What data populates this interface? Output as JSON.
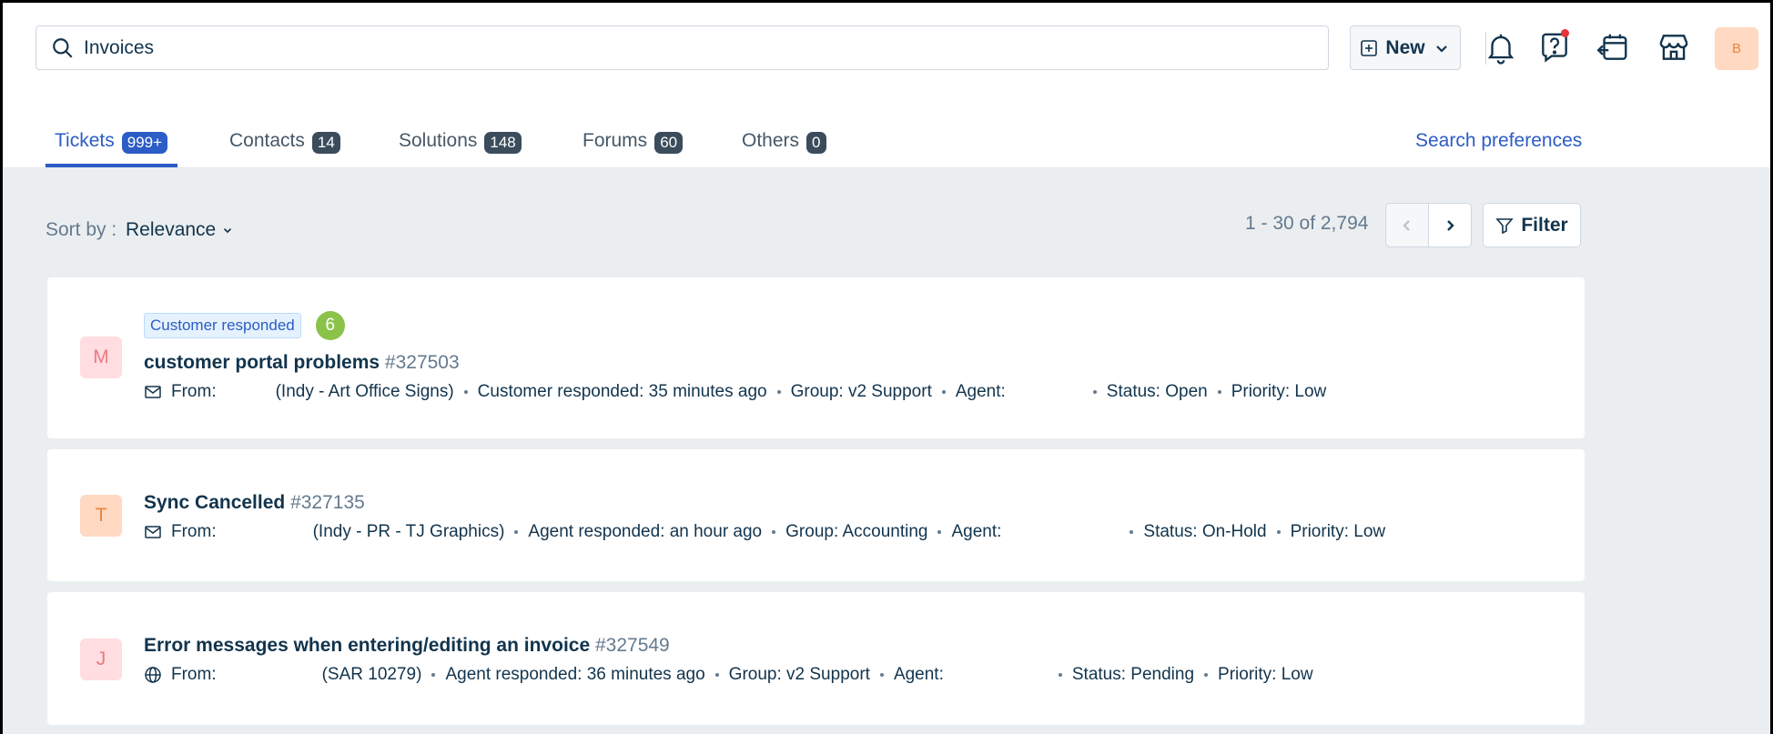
{
  "search": {
    "value": "Invoices"
  },
  "header": {
    "new_label": "New",
    "avatar_initial": "B"
  },
  "tabs": [
    {
      "label": "Tickets",
      "count": "999+"
    },
    {
      "label": "Contacts",
      "count": "14"
    },
    {
      "label": "Solutions",
      "count": "148"
    },
    {
      "label": "Forums",
      "count": "60"
    },
    {
      "label": "Others",
      "count": "0"
    }
  ],
  "search_preferences": "Search preferences",
  "sort": {
    "label": "Sort by :",
    "value": "Relevance"
  },
  "pagination": {
    "text": "1 - 30 of 2,794"
  },
  "filter_label": "Filter",
  "tickets": [
    {
      "initial": "M",
      "badge": "Customer responded",
      "count": "6",
      "title": "customer portal problems",
      "id": "#327503",
      "from_label": "From:",
      "company": "(Indy - Art Office Signs)",
      "activity": "Customer responded: 35 minutes ago",
      "group": "Group: v2 Support",
      "agent": "Agent:",
      "status": "Status: Open",
      "priority": "Priority: Low"
    },
    {
      "initial": "T",
      "title": "Sync Cancelled",
      "id": "#327135",
      "from_label": "From:",
      "company": "(Indy - PR - TJ Graphics)",
      "activity": "Agent responded: an hour ago",
      "group": "Group: Accounting",
      "agent": "Agent:",
      "status": "Status: On-Hold",
      "priority": "Priority: Low"
    },
    {
      "initial": "J",
      "title": "Error messages when entering/editing an invoice",
      "id": "#327549",
      "from_label": "From:",
      "company": "(SAR 10279)",
      "activity": "Agent responded: 36 minutes ago",
      "group": "Group: v2 Support",
      "agent": "Agent:",
      "status": "Status: Pending",
      "priority": "Priority: Low"
    }
  ]
}
